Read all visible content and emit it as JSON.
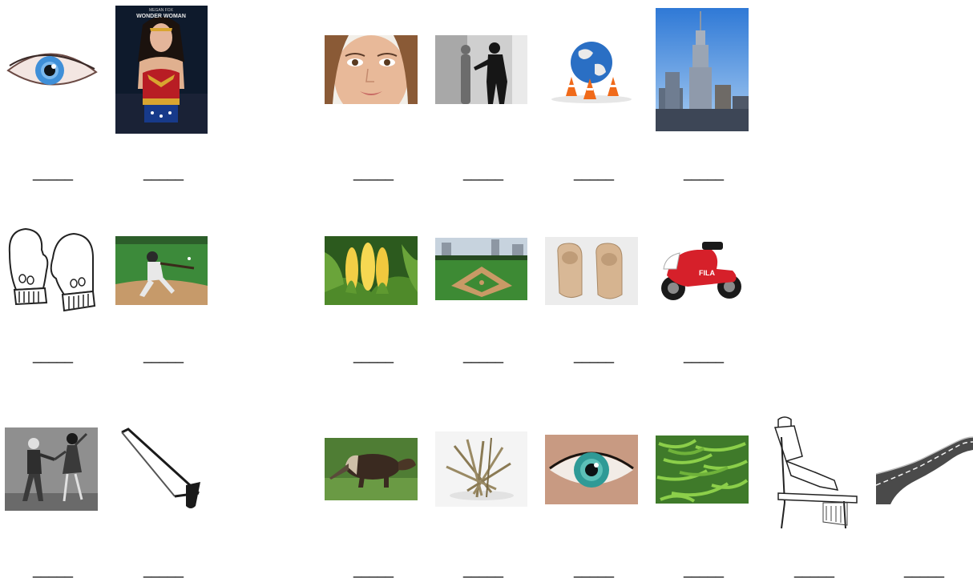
{
  "worksheet": {
    "pictures": [
      {
        "icon": "eye-icon"
      },
      {
        "icon": "wonder-woman-poster-icon",
        "caption_small": "MEGAN FOX",
        "caption": "WONDER WOMAN"
      },
      {
        "icon": "woman-face-icon"
      },
      {
        "icon": "shadow-figures-icon"
      },
      {
        "icon": "globe-cones-icon"
      },
      {
        "icon": "skyscraper-icon"
      },
      {
        "icon": "mittens-icon"
      },
      {
        "icon": "baseball-batter-icon"
      },
      {
        "icon": "corn-icon"
      },
      {
        "icon": "baseball-field-icon"
      },
      {
        "icon": "clogs-icon"
      },
      {
        "icon": "motorcycle-icon",
        "decal": "FILA"
      },
      {
        "icon": "dancing-couple-icon"
      },
      {
        "icon": "hacksaw-icon"
      },
      {
        "icon": "anteater-icon"
      },
      {
        "icon": "sticks-icon"
      },
      {
        "icon": "green-eye-icon"
      },
      {
        "icon": "green-beans-icon"
      },
      {
        "icon": "carpenter-sawing-icon"
      },
      {
        "icon": "road-icon"
      }
    ],
    "blank_text": "_____"
  }
}
